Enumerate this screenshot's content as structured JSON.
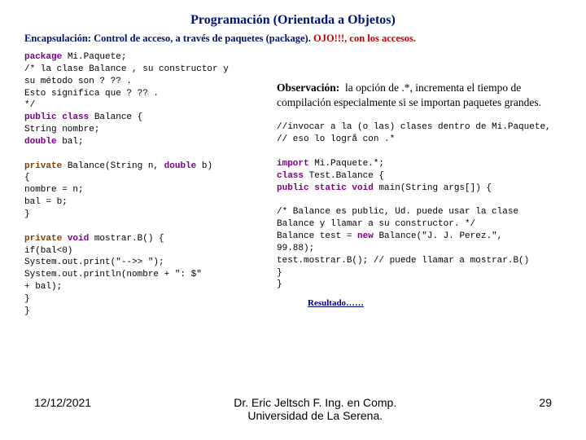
{
  "title": "Programación (Orientada a Objetos)",
  "subtitle_main": "Encapsulación: Control de acceso, a través de paquetes (package). ",
  "subtitle_ojo": "OJO!!!, con los accesos.",
  "code_left": {
    "l1a": "package",
    "l1b": " Mi.Paquete;",
    "l2": "/* la clase Balance , su constructor y",
    "l3": "su método son ? ?? .",
    "l4": "   Esto significa que  ? ?? .",
    "l5": "*/",
    "l6a": "public class",
    "l6b": " Balance {",
    "l7": "  String nombre;",
    "l8a": "  double",
    "l8b": " bal;",
    "blank1": " ",
    "l9a": "  private",
    "l9b": " Balance(String n, ",
    "l9c": "double",
    "l9d": " b)",
    "l10": "{",
    "l11": "    nombre = n;",
    "l12": "    bal = b;",
    "l13": "  }",
    "blank2": " ",
    "l14a": "  private",
    "l14b": " void",
    "l14c": " mostrar.B() {",
    "l15": "    if(bal<0)",
    "l16": "    System.out.print(\"-->> \");",
    "l17": "    System.out.println(nombre + \": $\"",
    "l18": "+ bal);",
    "l19": "  }",
    "l20": "}"
  },
  "obs_label": "Observación:",
  "obs_text": "la opción de .*, incrementa el tiempo de compilación especialmente si se importan paquetes grandes.",
  "code_right": {
    "c1": "//invocar a la (o las) clases dentro de Mi.Paquete,",
    "c2": "// eso lo logrå con .*",
    "blank": " ",
    "r1a": "import",
    "r1b": " Mi.Paquete.*;",
    "r2a": "class",
    "r2b": " Test.Balance {",
    "r3a": "  public static void",
    "r3b": " main(String args[]) {",
    "blank2": " ",
    "r4": "    /* Balance es public, Ud. puede usar la clase",
    "r5": "Balance y llamar a su constructor. */",
    "r6a": "    Balance test = ",
    "r6b": "new",
    "r6c": " Balance(\"J. J. Perez.\",",
    "r7": "99.88);",
    "r8": "    test.mostrar.B(); // puede llamar a mostrar.B()",
    "r9": "  }",
    "r10": "}"
  },
  "resultado": "Resultado……",
  "footer": {
    "left": "12/12/2021",
    "center_l1": "Dr. Eric Jeltsch F. Ing. en Comp.",
    "center_l2": "Universidad de La Serena.",
    "right": "29"
  }
}
